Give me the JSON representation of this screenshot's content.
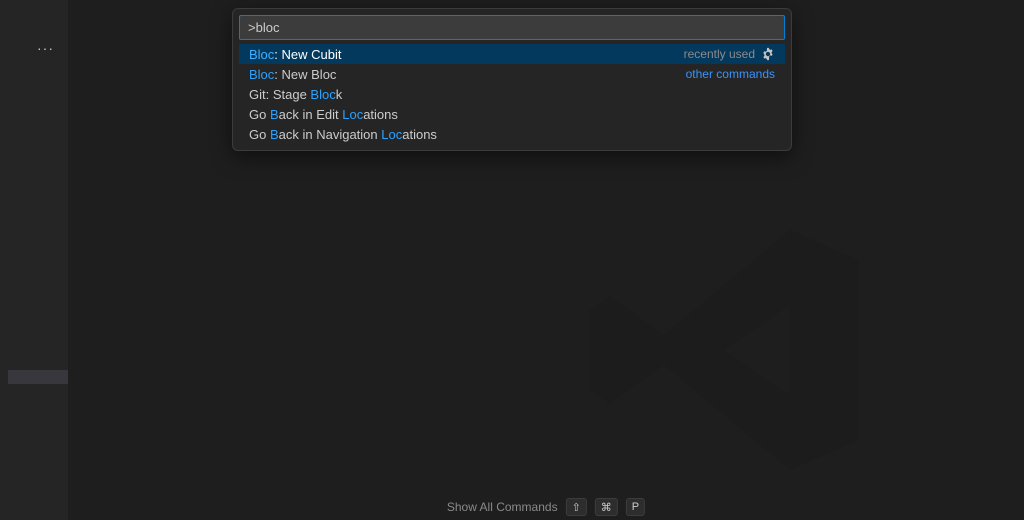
{
  "palette": {
    "input_value": ">bloc",
    "rows": [
      {
        "segments": [
          {
            "t": "Bloc",
            "hl": true
          },
          {
            "t": ": New Cubit",
            "hl": false
          }
        ],
        "side_text": "recently used",
        "side_link": false,
        "gear": true,
        "selected": true
      },
      {
        "segments": [
          {
            "t": "Bloc",
            "hl": true
          },
          {
            "t": ": New Bloc",
            "hl": false
          }
        ],
        "side_text": "other commands",
        "side_link": true,
        "gear": false,
        "selected": false
      },
      {
        "segments": [
          {
            "t": "Git: Stage ",
            "hl": false
          },
          {
            "t": "Bloc",
            "hl": true
          },
          {
            "t": "k",
            "hl": false
          }
        ],
        "side_text": "",
        "side_link": false,
        "gear": false,
        "selected": false
      },
      {
        "segments": [
          {
            "t": "Go ",
            "hl": false
          },
          {
            "t": "B",
            "hl": true
          },
          {
            "t": "ack in Edit ",
            "hl": false
          },
          {
            "t": "Loc",
            "hl": true
          },
          {
            "t": "ations",
            "hl": false
          }
        ],
        "side_text": "",
        "side_link": false,
        "gear": false,
        "selected": false
      },
      {
        "segments": [
          {
            "t": "Go ",
            "hl": false
          },
          {
            "t": "B",
            "hl": true
          },
          {
            "t": "ack in Navigation ",
            "hl": false
          },
          {
            "t": "Loc",
            "hl": true
          },
          {
            "t": "ations",
            "hl": false
          }
        ],
        "side_text": "",
        "side_link": false,
        "gear": false,
        "selected": false
      }
    ]
  },
  "hint": {
    "label": "Show All Commands",
    "keys": [
      "⇧",
      "⌘",
      "P"
    ]
  }
}
